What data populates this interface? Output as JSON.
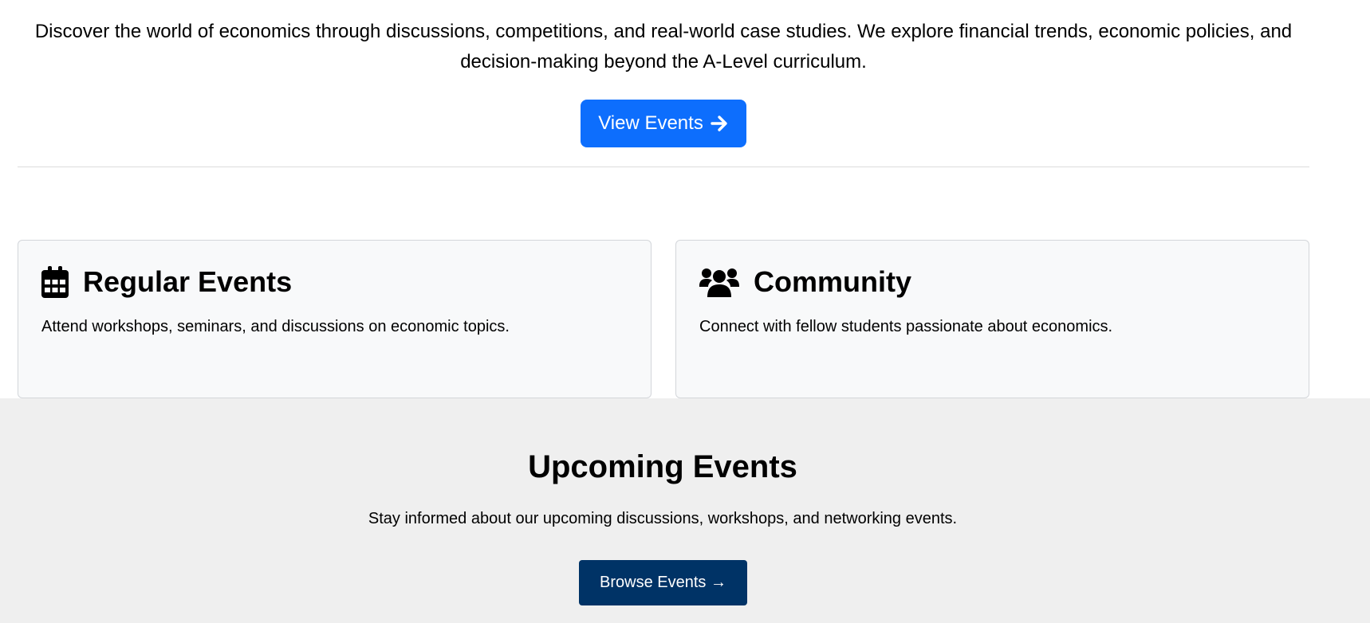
{
  "hero": {
    "description": "Discover the world of economics through discussions, competitions, and real-world case studies. We explore financial trends, economic policies, and decision-making beyond the A-Level curriculum.",
    "view_events_label": "View Events",
    "view_events_icon": "arrow-right-icon"
  },
  "features": [
    {
      "icon": "calendar-icon",
      "title": "Regular Events",
      "text": "Attend workshops, seminars, and discussions on economic topics."
    },
    {
      "icon": "users-icon",
      "title": "Community",
      "text": "Connect with fellow students passionate about economics."
    }
  ],
  "upcoming": {
    "title": "Upcoming Events",
    "subtitle": "Stay informed about our upcoming discussions, workshops, and networking events.",
    "browse_label": "Browse Events →"
  },
  "colors": {
    "primary_button": "#0d6efd",
    "browse_button": "#003366",
    "card_background": "#f8f9fa",
    "section_background": "#efefef"
  }
}
